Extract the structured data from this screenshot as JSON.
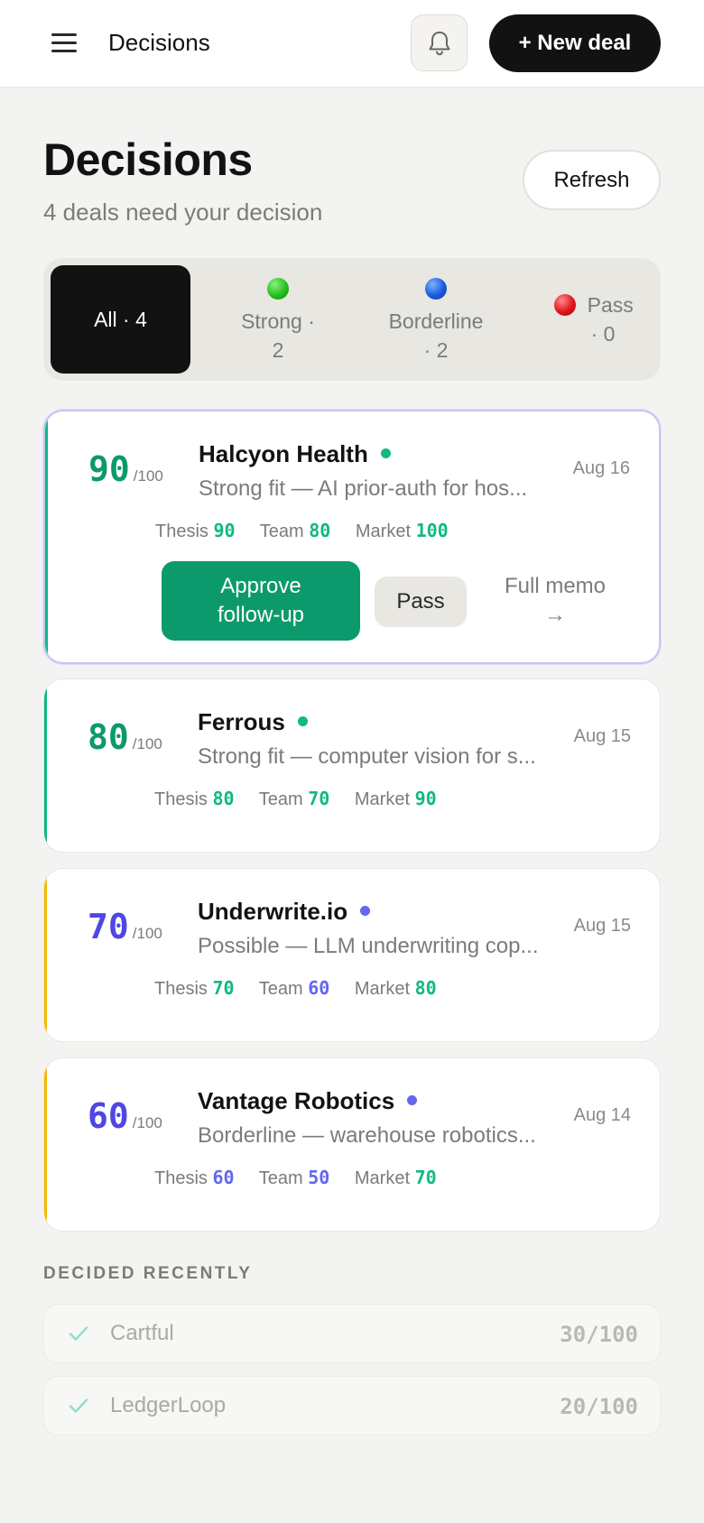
{
  "topbar": {
    "menu_icon": "hamburger-menu-icon",
    "title": "Decisions",
    "bell_icon": "bell-icon",
    "new_deal_label": "+ New deal"
  },
  "header": {
    "title": "Decisions",
    "subtitle": "4 deals need your decision",
    "refresh_label": "Refresh"
  },
  "filters": [
    {
      "label": "All · 4",
      "active": true
    },
    {
      "label_line1": "Strong ·",
      "label_line2": "2",
      "dot_color": "#22c01e"
    },
    {
      "label_line1": "Borderline",
      "label_line2": "· 2",
      "dot_color": "#1a5bdc"
    },
    {
      "label_line1": "Pass",
      "label_line2": "· 0",
      "dot_color": "#e0141e"
    }
  ],
  "colors": {
    "strong": "#0c9a6c",
    "borderline": "#4f46e5",
    "strong_dot": "#10b981",
    "borderline_dot": "#6366f1",
    "accent_strong": "#10b981",
    "accent_borderline": "#f5b800",
    "approve_bg": "#0c9a6c"
  },
  "deals": [
    {
      "score": "90",
      "score_den": "/100",
      "name": "Halcyon Health",
      "desc": "Strong fit — AI prior-auth for hos...",
      "date": "Aug 16",
      "metrics": [
        {
          "label": "Thesis",
          "value": "90"
        },
        {
          "label": "Team",
          "value": "80"
        },
        {
          "label": "Market",
          "value": "100"
        }
      ],
      "actions": {
        "approve": "Approve follow-up",
        "approve_l1": "Approve",
        "approve_l2": "follow-up",
        "pass": "Pass",
        "memo_l1": "Full memo",
        "memo_l2": "→"
      }
    },
    {
      "score": "80",
      "score_den": "/100",
      "name": "Ferrous",
      "desc": "Strong fit — computer vision for s...",
      "date": "Aug 15",
      "metrics": [
        {
          "label": "Thesis",
          "value": "80"
        },
        {
          "label": "Team",
          "value": "70"
        },
        {
          "label": "Market",
          "value": "90"
        }
      ]
    },
    {
      "score": "70",
      "score_den": "/100",
      "name": "Underwrite.io",
      "desc": "Possible — LLM underwriting cop...",
      "date": "Aug 15",
      "metrics": [
        {
          "label": "Thesis",
          "value": "70"
        },
        {
          "label": "Team",
          "value": "60"
        },
        {
          "label": "Market",
          "value": "80"
        }
      ]
    },
    {
      "score": "60",
      "score_den": "/100",
      "name": "Vantage Robotics",
      "desc": "Borderline — warehouse robotics...",
      "date": "Aug 14",
      "metrics": [
        {
          "label": "Thesis",
          "value": "60"
        },
        {
          "label": "Team",
          "value": "50"
        },
        {
          "label": "Market",
          "value": "70"
        }
      ]
    }
  ],
  "decided": {
    "label": "DECIDED RECENTLY",
    "items": [
      {
        "name": "Cartful",
        "score": "30/100",
        "icon": "check-icon"
      },
      {
        "name": "LedgerLoop",
        "score": "20/100",
        "icon": "check-icon"
      }
    ]
  }
}
